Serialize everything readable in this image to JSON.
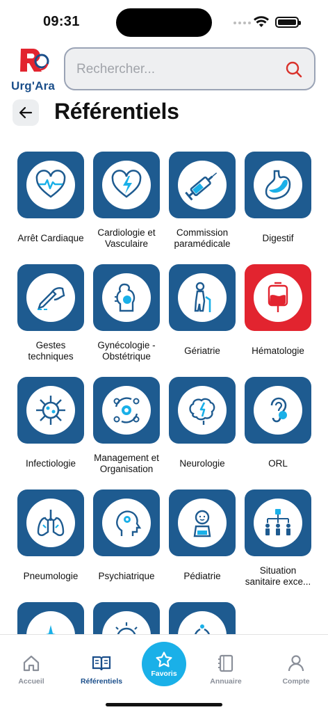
{
  "status": {
    "time": "09:31"
  },
  "header": {
    "logo_text": "Urg'Ara",
    "search_placeholder": "Rechercher...",
    "title": "Référentiels"
  },
  "tiles": [
    {
      "label": "Arrêt Cardiaque",
      "icon": "heart-pulse-icon"
    },
    {
      "label": "Cardiologie et Vasculaire",
      "icon": "heart-bolt-icon"
    },
    {
      "label": "Commission paramédicale",
      "icon": "syringe-icon"
    },
    {
      "label": "Digestif",
      "icon": "stomach-icon"
    },
    {
      "label": "Gestes techniques",
      "icon": "hand-pen-icon"
    },
    {
      "label": "Gynécologie - Obstétrique",
      "icon": "pregnancy-icon"
    },
    {
      "label": "Gériatrie",
      "icon": "elderly-icon"
    },
    {
      "label": "Hématologie",
      "icon": "blood-bag-icon"
    },
    {
      "label": "Infectiologie",
      "icon": "virus-icon"
    },
    {
      "label": "Management et Organisation",
      "icon": "gear-cycle-icon"
    },
    {
      "label": "Neurologie",
      "icon": "brain-icon"
    },
    {
      "label": "ORL",
      "icon": "ear-icon"
    },
    {
      "label": "Pneumologie",
      "icon": "lungs-icon"
    },
    {
      "label": "Psychiatrique",
      "icon": "head-gear-icon"
    },
    {
      "label": "Pédiatrie",
      "icon": "baby-icon"
    },
    {
      "label": "Situation sanitaire exce...",
      "icon": "hierarchy-icon"
    },
    {
      "label": "",
      "icon": "partial-icon"
    },
    {
      "label": "",
      "icon": "partial-icon"
    },
    {
      "label": "",
      "icon": "partial-icon"
    }
  ],
  "tabbar": {
    "home": "Accueil",
    "referentiels": "Référentiels",
    "favoris": "Favoris",
    "annuaire": "Annuaire",
    "compte": "Compte"
  },
  "colors": {
    "tile_bg": "#1e5b90",
    "accent": "#1ab0e8",
    "brand_red": "#e2242f"
  }
}
